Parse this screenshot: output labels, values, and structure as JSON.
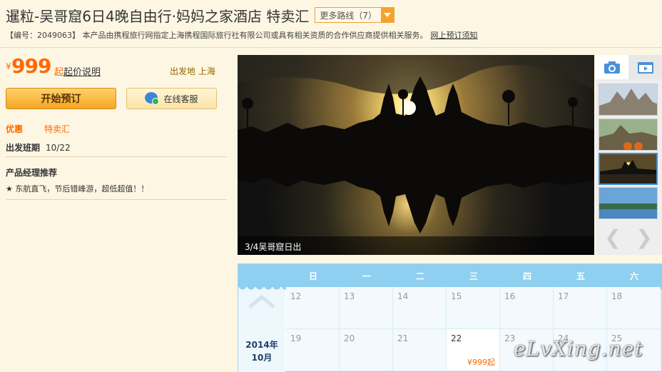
{
  "header": {
    "title": "暹粒-吴哥窟6日4晚自由行·妈妈之家酒店 特卖汇",
    "more_routes": "更多路线（7）",
    "sub_text": "【编号：2049063】 本产品由携程旅行网指定上海携程国际旅行社有限公司或具有相关资质的合作供应商提供相关服务。",
    "booking_notice": "网上预订须知"
  },
  "price": {
    "currency": "¥",
    "amount": "999",
    "suffix": "起",
    "note_link": "起价说明",
    "depart": "出发地 上海"
  },
  "buttons": {
    "book": "开始预订",
    "service": "在线客服"
  },
  "info": {
    "promo_label": "优惠",
    "promo_value": "特卖汇",
    "schedule_label": "出发班期",
    "schedule_value": "10/22",
    "rec_title": "产品经理推荐",
    "rec_text": "★ 东航直飞，节后错峰游，超低超值！！"
  },
  "gallery": {
    "caption": "3/4吴哥窟日出",
    "active_index": 3,
    "thumb_count": 4
  },
  "calendar": {
    "weekdays": [
      "日",
      "一",
      "二",
      "三",
      "四",
      "五",
      "六"
    ],
    "month_label_year": "2014年",
    "month_label_month": "10月",
    "row1": [
      "12",
      "13",
      "14",
      "15",
      "16",
      "17",
      "18"
    ],
    "row2": [
      "19",
      "20",
      "21",
      "22",
      "23",
      "24",
      "25"
    ],
    "price_day": "22",
    "price_text": "¥999起"
  },
  "watermark": "eLvXing.net",
  "colors": {
    "accent": "#ff6a00",
    "calendar_header": "#8fd0f0",
    "page_bg": "#fdf6e3"
  }
}
